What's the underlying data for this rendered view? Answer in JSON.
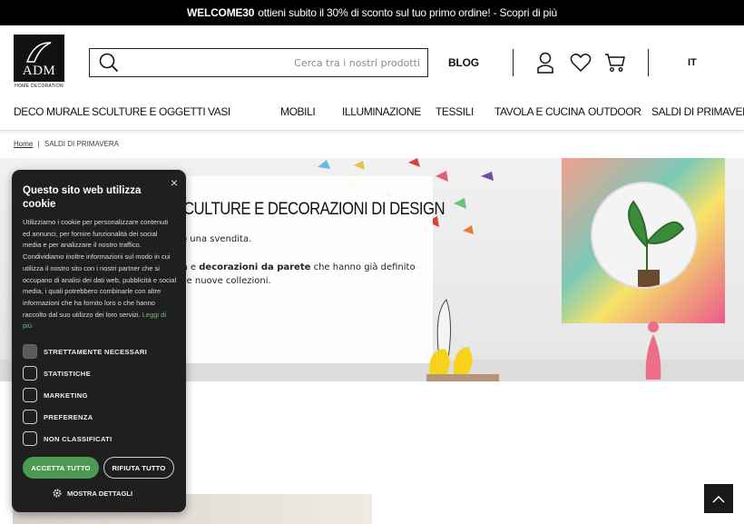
{
  "promo": {
    "code": "WELCOME30",
    "text": "ottieni subito il 30% di sconto sul tuo primo ordine! - Scopri di più"
  },
  "header": {
    "logo_text": "ADM",
    "logo_sub": "HOME DECORATION",
    "search_placeholder": "Cerca tra i nostri prodotti",
    "blog_label": "BLOG",
    "language": "IT"
  },
  "nav": {
    "items": [
      "DECO MURALE",
      "SCULTURE E OGGETTI",
      "VASI",
      "MOBILI",
      "ILLUMINAZIONE",
      "TESSILI",
      "TAVOLA E CUCINA",
      "OUTDOOR",
      "SALDI DI PRIMAVERA"
    ]
  },
  "breadcrumb": {
    "home": "Home",
    "separator": "|",
    "current": "SALDI DI PRIMAVERA"
  },
  "hero": {
    "title": "CULTURE E DECORAZIONI DI DESIGN",
    "line1": "o una svendita.",
    "line2_bold1": "a",
    "line2_mid": " e ",
    "line2_bold2": "decorazioni da parete",
    "line2_end": " che hanno già definito",
    "line3": "lle nuove collezioni."
  },
  "cookie": {
    "title": "Questo sito web utilizza cookie",
    "body": "Utilizziamo i cookie per personalizzare contenuti ed annunci, per fornire funzionalità dei social media e per analizzare il nostro traffico. Condividiamo inoltre informazioni sul modo in cui utilizza il nostro sito con i nostri partner che si occupano di analisi dei dati web, pubblicità e social media, i quali potrebbero combinarle con altre informazioni che ha fornito loro o che hanno raccolto dal suo utilizzo dei loro servizi.",
    "link": "Leggi di più",
    "options": [
      "STRETTAMENTE NECESSARI",
      "STATISTICHE",
      "MARKETING",
      "PREFERENZA",
      "NON CLASSIFICATI"
    ],
    "accept_label": "ACCETTA TUTTO",
    "reject_label": "RIFIUTA TUTTO",
    "details_label": "MOSTRA DETTAGLI",
    "close_symbol": "×"
  },
  "colors": {
    "accept": "#4c9a52",
    "topbar": "#000000",
    "cookie_bg": "#1f1f1f"
  },
  "icons": [
    "search-icon",
    "user-icon",
    "heart-icon",
    "cart-icon",
    "chevron-up-icon",
    "gear-icon",
    "close-icon"
  ]
}
